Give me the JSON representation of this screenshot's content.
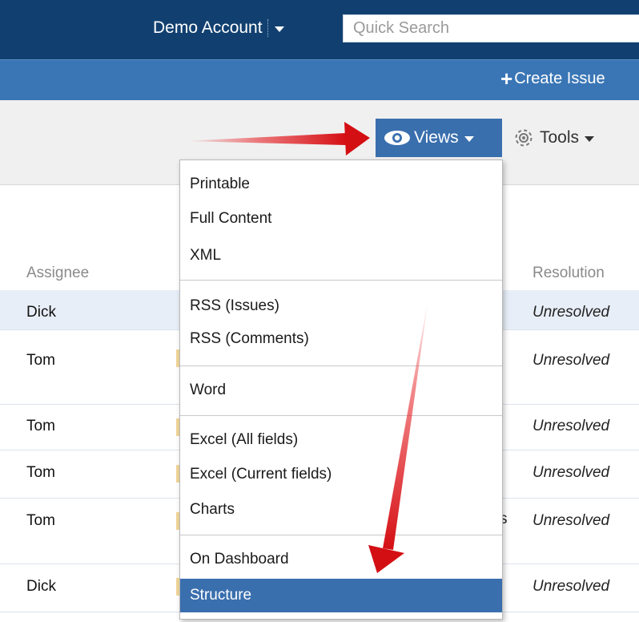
{
  "header": {
    "account_label": "Demo Account",
    "search_placeholder": "Quick Search"
  },
  "subbar": {
    "create_issue_label": "Create Issue"
  },
  "toolbar": {
    "views_label": "Views",
    "tools_label": "Tools"
  },
  "table": {
    "columns": {
      "assignee": "Assignee",
      "resolution": "Resolution"
    },
    "rows": [
      {
        "assignee": "Dick",
        "resolution": "Unresolved"
      },
      {
        "assignee": "Tom",
        "resolution": "Unresolved"
      },
      {
        "assignee": "Tom",
        "resolution": "Unresolved"
      },
      {
        "assignee": "Tom",
        "resolution": "Unresolved"
      },
      {
        "assignee": "Tom",
        "resolution": "Unresolved"
      },
      {
        "assignee": "Dick",
        "resolution": "Unresolved"
      }
    ],
    "partial_text": "s"
  },
  "views_menu": {
    "items": [
      {
        "label": "Printable"
      },
      {
        "label": "Full Content"
      },
      {
        "label": "XML"
      },
      {
        "label": "RSS (Issues)"
      },
      {
        "label": "RSS (Comments)"
      },
      {
        "label": "Word"
      },
      {
        "label": "Excel (All fields)"
      },
      {
        "label": "Excel (Current fields)"
      },
      {
        "label": "Charts"
      },
      {
        "label": "On Dashboard"
      },
      {
        "label": "Structure"
      }
    ],
    "selected": "Structure"
  },
  "colors": {
    "top_bar": "#114070",
    "sub_bar": "#3a76b5",
    "accent": "#3a6fae",
    "annotation_arrow": "#e5171b"
  },
  "icons": {
    "views": "eye-icon",
    "tools": "gear-icon",
    "create": "plus-icon"
  }
}
